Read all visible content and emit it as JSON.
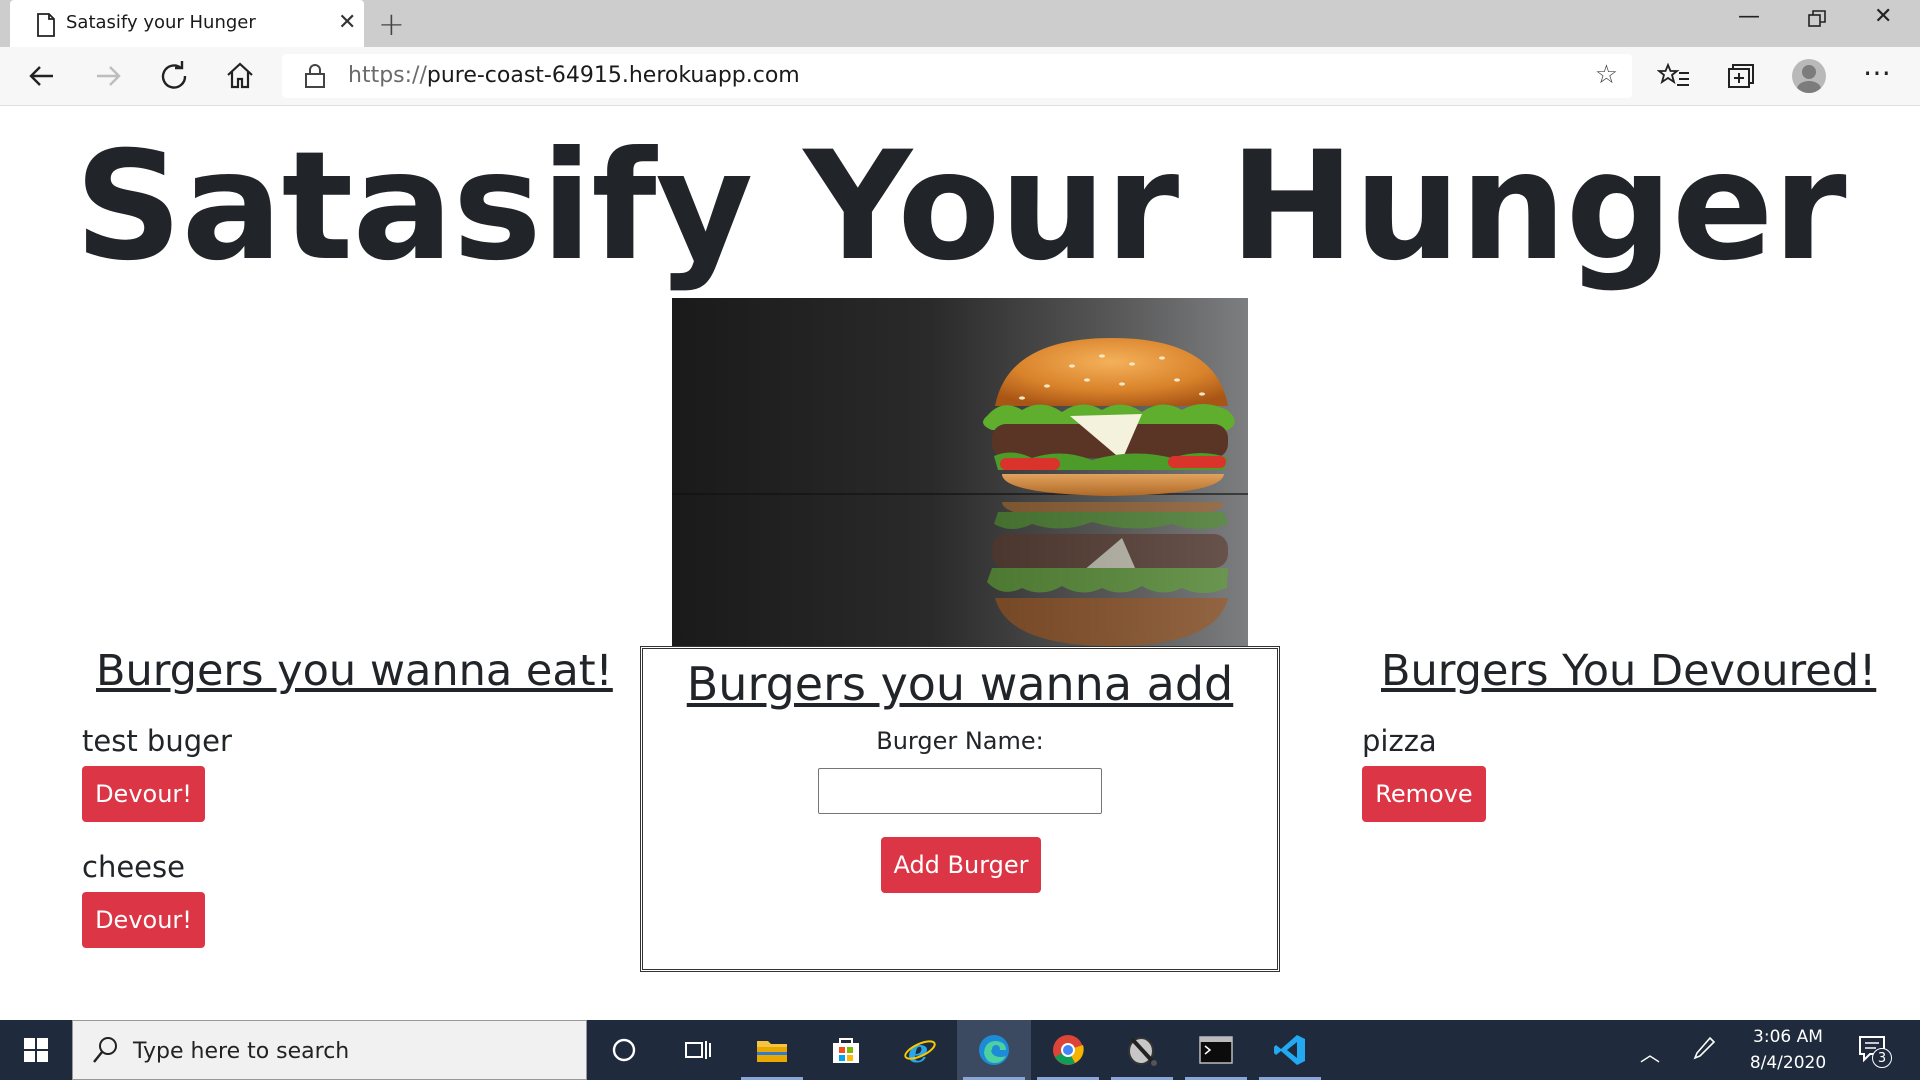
{
  "browser": {
    "tab_title": "Satasify your Hunger",
    "url_scheme": "https://",
    "url_host": "pure-coast-64915.herokuapp.com"
  },
  "page": {
    "title": "Satasify Your Hunger",
    "left_column": {
      "heading": "Burgers you wanna eat!",
      "items": [
        {
          "name": "test buger",
          "button": "Devour!"
        },
        {
          "name": "cheese",
          "button": "Devour!"
        }
      ]
    },
    "add_panel": {
      "heading": "Burgers you wanna add",
      "label": "Burger Name:",
      "input_value": "",
      "button": "Add Burger"
    },
    "right_column": {
      "heading": "Burgers You Devoured!",
      "items": [
        {
          "name": "pizza",
          "button": "Remove"
        }
      ]
    }
  },
  "taskbar": {
    "search_placeholder": "Type here to search",
    "time": "3:06 AM",
    "date": "8/4/2020",
    "notification_count": "3"
  },
  "colors": {
    "button_danger": "#dc3545",
    "taskbar": "#1f2a3c"
  }
}
